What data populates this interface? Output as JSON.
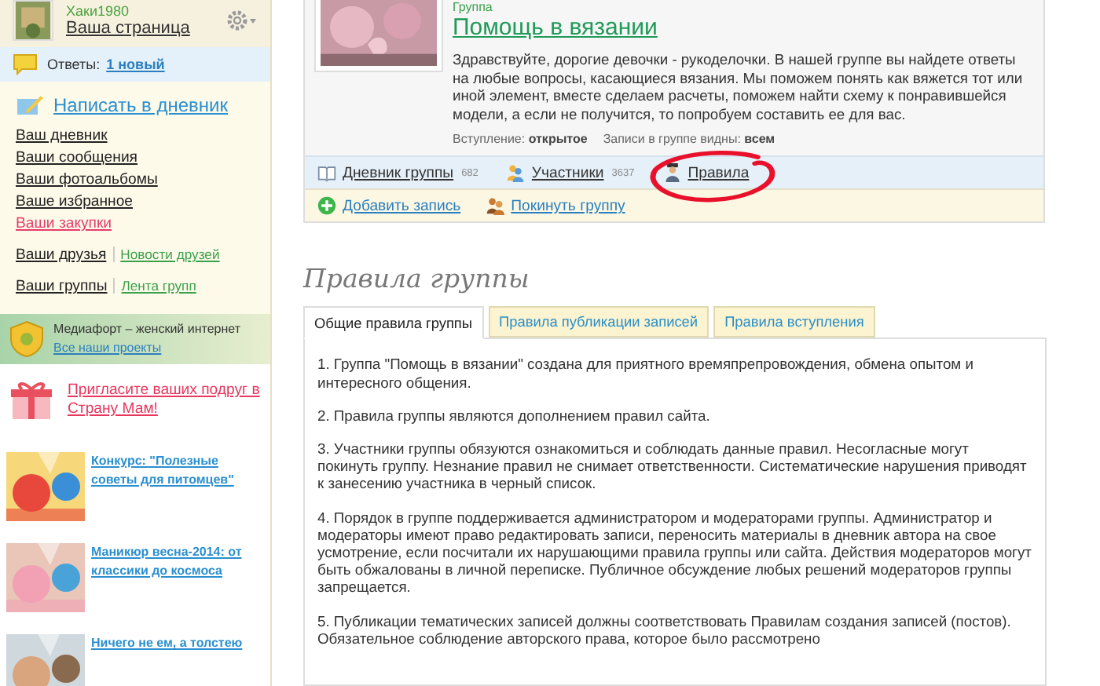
{
  "user": {
    "name": "Хаки1980",
    "page_link": "Ваша страница"
  },
  "answers": {
    "label": "Ответы:",
    "link": "1 новый"
  },
  "write_link": "Написать в дневник",
  "menu": [
    {
      "label": "Ваш дневник",
      "kind": "plain"
    },
    {
      "label": "Ваши сообщения",
      "kind": "plain"
    },
    {
      "label": "Ваши фотоальбомы",
      "kind": "plain"
    },
    {
      "label": "Ваше избранное",
      "kind": "plain"
    },
    {
      "label": "Ваши закупки",
      "kind": "accent"
    }
  ],
  "social": [
    {
      "label": "Ваши друзья",
      "extra": "Новости друзей"
    },
    {
      "label": "Ваши группы",
      "extra": "Лента групп"
    }
  ],
  "mediafort": {
    "text": "Медиафорт – женский интернет",
    "link": "Все наши проекты"
  },
  "invite": "Пригласите ваших подруг в Страну Мам!",
  "promos": [
    {
      "title": "Конкурс: \"Полезные советы для питомцев\""
    },
    {
      "title": "Маникюр весна-2014: от классики до космоса"
    },
    {
      "title": "Ничего не ем, а толстею"
    }
  ],
  "group": {
    "kicker": "Группа",
    "title": "Помощь в вязании",
    "description": "Здравствуйте, дорогие девочки - рукоделочки. В нашей группе вы найдете ответы на любые вопросы, касающиеся вязания. Мы поможем понять как вяжется тот или иной элемент, вместе сделаем расчеты, поможем найти схему к понравившейся модели, а если не получится, то попробуем составить ее для вас.",
    "meta": [
      {
        "label": "Вступление:",
        "value": "открытое"
      },
      {
        "label": "Записи в группе видны:",
        "value": "всем"
      }
    ],
    "nav": [
      {
        "label": "Дневник группы",
        "count": "682",
        "kind": "diary",
        "circled": false
      },
      {
        "label": "Участники",
        "count": "3637",
        "kind": "members",
        "circled": false
      },
      {
        "label": "Правила",
        "kind": "rules",
        "circled": true
      }
    ],
    "actions": [
      {
        "label": "Добавить запись",
        "kind": "add"
      },
      {
        "label": "Покинуть группу",
        "kind": "leave"
      }
    ]
  },
  "rules": {
    "heading": "Правила группы",
    "tabs": [
      {
        "label": "Общие правила группы",
        "selected": true
      },
      {
        "label": "Правила публикации записей",
        "selected": false
      },
      {
        "label": "Правила вступления",
        "selected": false
      }
    ],
    "items": [
      "1. Группа \"Помощь в вязании\" создана для приятного времяпрепровождения, обмена опытом и интересного общения.",
      "2. Правила группы являются дополнением правил сайта.",
      "3. Участники группы обязуются ознакомиться и соблюдать данные правил. Несогласные могут покинуть группу. Незнание правил не снимает ответственности. Систематические нарушения приводят к занесению участника в черный список.",
      "4. Порядок в группе поддерживается администратором и модераторами группы. Администратор и модераторы имеют право редактировать записи, переносить материалы в дневник автора на свое усмотрение, если посчитали их нарушающими правила группы или сайта. Действия модераторов могут быть обжалованы в личной переписке. Публичное обсуждение любых решений модераторов группы запрещается.",
      "5. Публикации тематических записей должны соответствовать Правилам создания записей (постов). Обязательное соблюдение авторского права, которое было рассмотрено"
    ]
  }
}
